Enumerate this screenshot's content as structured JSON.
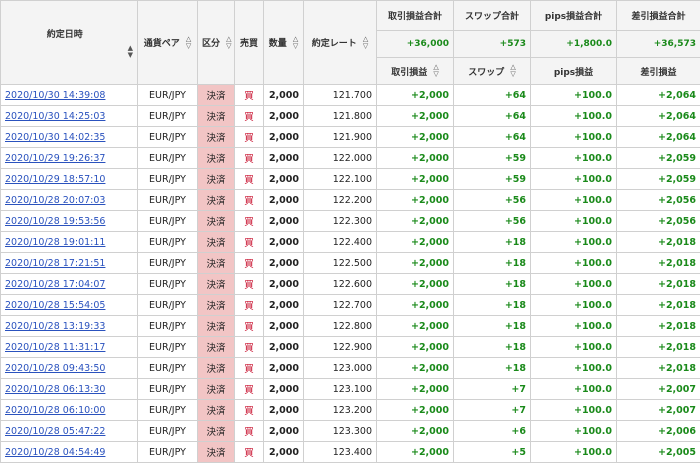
{
  "headers": {
    "date": "約定日時",
    "pair": "通貨ペア",
    "kubun": "区分",
    "side": "売買",
    "qty": "数量",
    "rate": "約定レート",
    "pnl_total": "取引損益合計",
    "swap_total": "スワップ合計",
    "pips_total": "pips損益合計",
    "net_total": "差引損益合計",
    "pnl": "取引損益",
    "swap": "スワップ",
    "pips": "pips損益",
    "net": "差引損益"
  },
  "totals": {
    "pnl": "+36,000",
    "swap": "+573",
    "pips": "+1,800.0",
    "net": "+36,573"
  },
  "sort_icons": {
    "up": "▲",
    "down": "▽",
    "down_filled": "▼",
    "up_hollow": "△"
  },
  "rows": [
    {
      "date": "2020/10/30 14:39:08",
      "pair": "EUR/JPY",
      "kubun": "決済",
      "side": "買",
      "qty": "2,000",
      "rate": "121.700",
      "pnl": "+2,000",
      "swap": "+64",
      "pips": "+100.0",
      "net": "+2,064"
    },
    {
      "date": "2020/10/30 14:25:03",
      "pair": "EUR/JPY",
      "kubun": "決済",
      "side": "買",
      "qty": "2,000",
      "rate": "121.800",
      "pnl": "+2,000",
      "swap": "+64",
      "pips": "+100.0",
      "net": "+2,064"
    },
    {
      "date": "2020/10/30 14:02:35",
      "pair": "EUR/JPY",
      "kubun": "決済",
      "side": "買",
      "qty": "2,000",
      "rate": "121.900",
      "pnl": "+2,000",
      "swap": "+64",
      "pips": "+100.0",
      "net": "+2,064"
    },
    {
      "date": "2020/10/29 19:26:37",
      "pair": "EUR/JPY",
      "kubun": "決済",
      "side": "買",
      "qty": "2,000",
      "rate": "122.000",
      "pnl": "+2,000",
      "swap": "+59",
      "pips": "+100.0",
      "net": "+2,059"
    },
    {
      "date": "2020/10/29 18:57:10",
      "pair": "EUR/JPY",
      "kubun": "決済",
      "side": "買",
      "qty": "2,000",
      "rate": "122.100",
      "pnl": "+2,000",
      "swap": "+59",
      "pips": "+100.0",
      "net": "+2,059"
    },
    {
      "date": "2020/10/28 20:07:03",
      "pair": "EUR/JPY",
      "kubun": "決済",
      "side": "買",
      "qty": "2,000",
      "rate": "122.200",
      "pnl": "+2,000",
      "swap": "+56",
      "pips": "+100.0",
      "net": "+2,056"
    },
    {
      "date": "2020/10/28 19:53:56",
      "pair": "EUR/JPY",
      "kubun": "決済",
      "side": "買",
      "qty": "2,000",
      "rate": "122.300",
      "pnl": "+2,000",
      "swap": "+56",
      "pips": "+100.0",
      "net": "+2,056"
    },
    {
      "date": "2020/10/28 19:01:11",
      "pair": "EUR/JPY",
      "kubun": "決済",
      "side": "買",
      "qty": "2,000",
      "rate": "122.400",
      "pnl": "+2,000",
      "swap": "+18",
      "pips": "+100.0",
      "net": "+2,018"
    },
    {
      "date": "2020/10/28 17:21:51",
      "pair": "EUR/JPY",
      "kubun": "決済",
      "side": "買",
      "qty": "2,000",
      "rate": "122.500",
      "pnl": "+2,000",
      "swap": "+18",
      "pips": "+100.0",
      "net": "+2,018"
    },
    {
      "date": "2020/10/28 17:04:07",
      "pair": "EUR/JPY",
      "kubun": "決済",
      "side": "買",
      "qty": "2,000",
      "rate": "122.600",
      "pnl": "+2,000",
      "swap": "+18",
      "pips": "+100.0",
      "net": "+2,018"
    },
    {
      "date": "2020/10/28 15:54:05",
      "pair": "EUR/JPY",
      "kubun": "決済",
      "side": "買",
      "qty": "2,000",
      "rate": "122.700",
      "pnl": "+2,000",
      "swap": "+18",
      "pips": "+100.0",
      "net": "+2,018"
    },
    {
      "date": "2020/10/28 13:19:33",
      "pair": "EUR/JPY",
      "kubun": "決済",
      "side": "買",
      "qty": "2,000",
      "rate": "122.800",
      "pnl": "+2,000",
      "swap": "+18",
      "pips": "+100.0",
      "net": "+2,018"
    },
    {
      "date": "2020/10/28 11:31:17",
      "pair": "EUR/JPY",
      "kubun": "決済",
      "side": "買",
      "qty": "2,000",
      "rate": "122.900",
      "pnl": "+2,000",
      "swap": "+18",
      "pips": "+100.0",
      "net": "+2,018"
    },
    {
      "date": "2020/10/28 09:43:50",
      "pair": "EUR/JPY",
      "kubun": "決済",
      "side": "買",
      "qty": "2,000",
      "rate": "123.000",
      "pnl": "+2,000",
      "swap": "+18",
      "pips": "+100.0",
      "net": "+2,018"
    },
    {
      "date": "2020/10/28 06:13:30",
      "pair": "EUR/JPY",
      "kubun": "決済",
      "side": "買",
      "qty": "2,000",
      "rate": "123.100",
      "pnl": "+2,000",
      "swap": "+7",
      "pips": "+100.0",
      "net": "+2,007"
    },
    {
      "date": "2020/10/28 06:10:00",
      "pair": "EUR/JPY",
      "kubun": "決済",
      "side": "買",
      "qty": "2,000",
      "rate": "123.200",
      "pnl": "+2,000",
      "swap": "+7",
      "pips": "+100.0",
      "net": "+2,007"
    },
    {
      "date": "2020/10/28 05:47:22",
      "pair": "EUR/JPY",
      "kubun": "決済",
      "side": "買",
      "qty": "2,000",
      "rate": "123.300",
      "pnl": "+2,000",
      "swap": "+6",
      "pips": "+100.0",
      "net": "+2,006"
    },
    {
      "date": "2020/10/28 04:54:49",
      "pair": "EUR/JPY",
      "kubun": "決済",
      "side": "買",
      "qty": "2,000",
      "rate": "123.400",
      "pnl": "+2,000",
      "swap": "+5",
      "pips": "+100.0",
      "net": "+2,005"
    }
  ],
  "colors": {
    "positive": "#1a8a1a",
    "link": "#2a52be",
    "buy": "#c8102e",
    "kubun_bg": "#f2c5c5",
    "header_bg": "#f4f4f4"
  }
}
